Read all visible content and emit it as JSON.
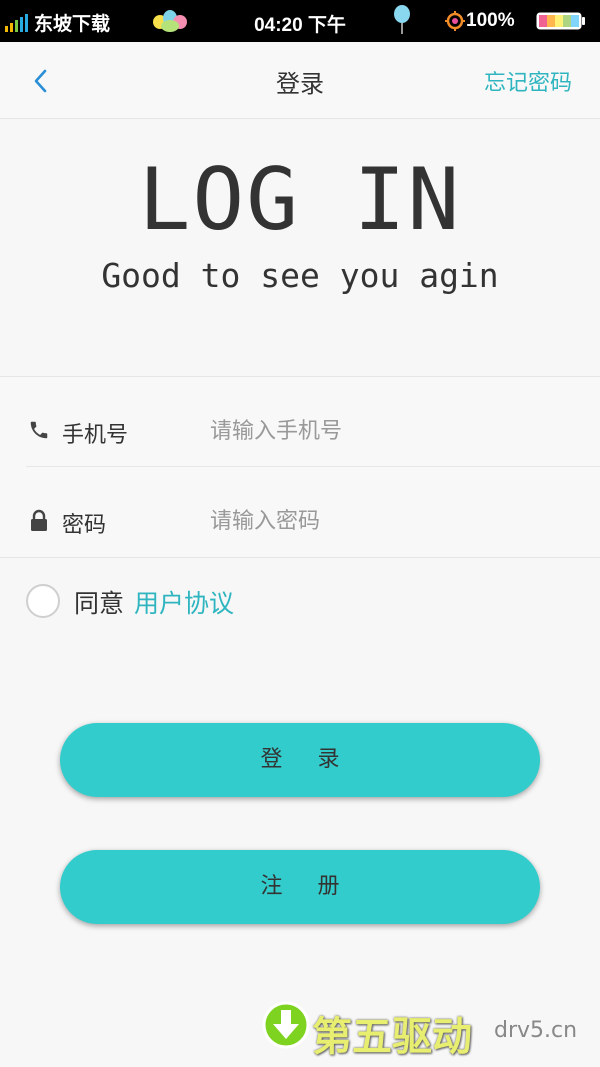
{
  "status_bar": {
    "carrier": "东坡下载",
    "time": "04:20 下午",
    "battery": "100%",
    "icons": [
      "signal-icon",
      "app-balloons-icon",
      "balloon-icon",
      "gps-icon",
      "battery-icon"
    ]
  },
  "header": {
    "title": "登录",
    "back_icon": "chevron-left-icon",
    "forgot_label": "忘记密码"
  },
  "hero": {
    "title": "LOG IN",
    "subtitle": "Good to see you agin"
  },
  "form": {
    "phone": {
      "icon": "phone-icon",
      "label": "手机号",
      "placeholder": "请输入手机号",
      "value": ""
    },
    "password": {
      "icon": "lock-icon",
      "label": "密码",
      "placeholder": "请输入密码",
      "value": ""
    }
  },
  "agreement": {
    "checked": false,
    "text": "同意",
    "link": "用户协议"
  },
  "buttons": {
    "login_label": "登 录",
    "register_label": "注 册"
  },
  "watermark": {
    "text": "第五驱动",
    "domain": "drv5.cn"
  },
  "colors": {
    "accent": "#2fb5c0",
    "button": "#33cccc",
    "status_bar": "#000000",
    "background": "#f7f7f7"
  }
}
